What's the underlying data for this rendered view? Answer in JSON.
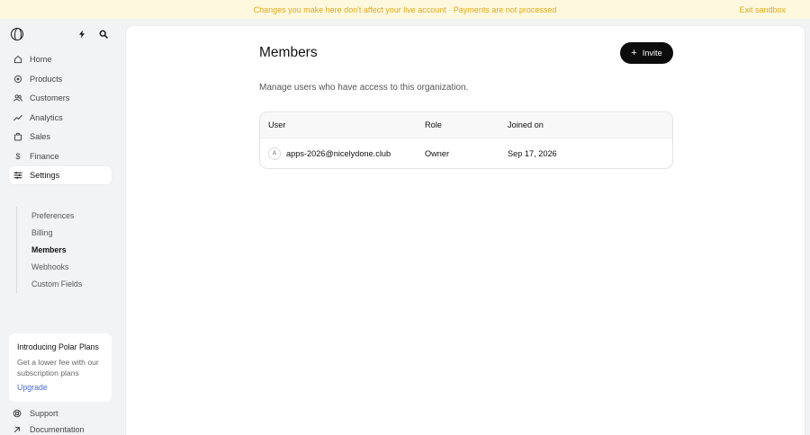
{
  "banner": {
    "message": "Changes you make here don't affect your live account · Payments are not processed",
    "exit_label": "Exit sandbox",
    "color": "#e0a81a"
  },
  "sidebar": {
    "top_icons": [
      "polar-logo",
      "bolt-icon",
      "search-icon"
    ],
    "items": [
      {
        "label": "Home",
        "icon": "home-icon"
      },
      {
        "label": "Products",
        "icon": "products-icon"
      },
      {
        "label": "Customers",
        "icon": "customers-icon"
      },
      {
        "label": "Analytics",
        "icon": "analytics-icon"
      },
      {
        "label": "Sales",
        "icon": "sales-icon"
      },
      {
        "label": "Finance",
        "icon": "dollar-icon"
      },
      {
        "label": "Settings",
        "icon": "settings-icon",
        "active": true
      }
    ],
    "settings_sub": [
      {
        "label": "Preferences"
      },
      {
        "label": "Billing"
      },
      {
        "label": "Members",
        "active": true
      },
      {
        "label": "Webhooks"
      },
      {
        "label": "Custom Fields"
      }
    ],
    "promo": {
      "title": "Introducing Polar Plans",
      "description": "Get a lower fee with our subscription plans",
      "link": "Upgrade",
      "link_color": "#4a6bd6"
    },
    "footer": [
      {
        "label": "Support",
        "icon": "support-icon"
      },
      {
        "label": "Documentation",
        "icon": "arrow-up-right-icon"
      }
    ]
  },
  "page": {
    "title": "Members",
    "invite_label": "Invite",
    "description": "Manage users who have access to this organization."
  },
  "table": {
    "headers": [
      "User",
      "Role",
      "Joined on"
    ],
    "rows": [
      {
        "avatar": "A",
        "user": "apps-2026@nicelydone.club",
        "role": "Owner",
        "joined": "Sep 17, 2026"
      }
    ]
  }
}
